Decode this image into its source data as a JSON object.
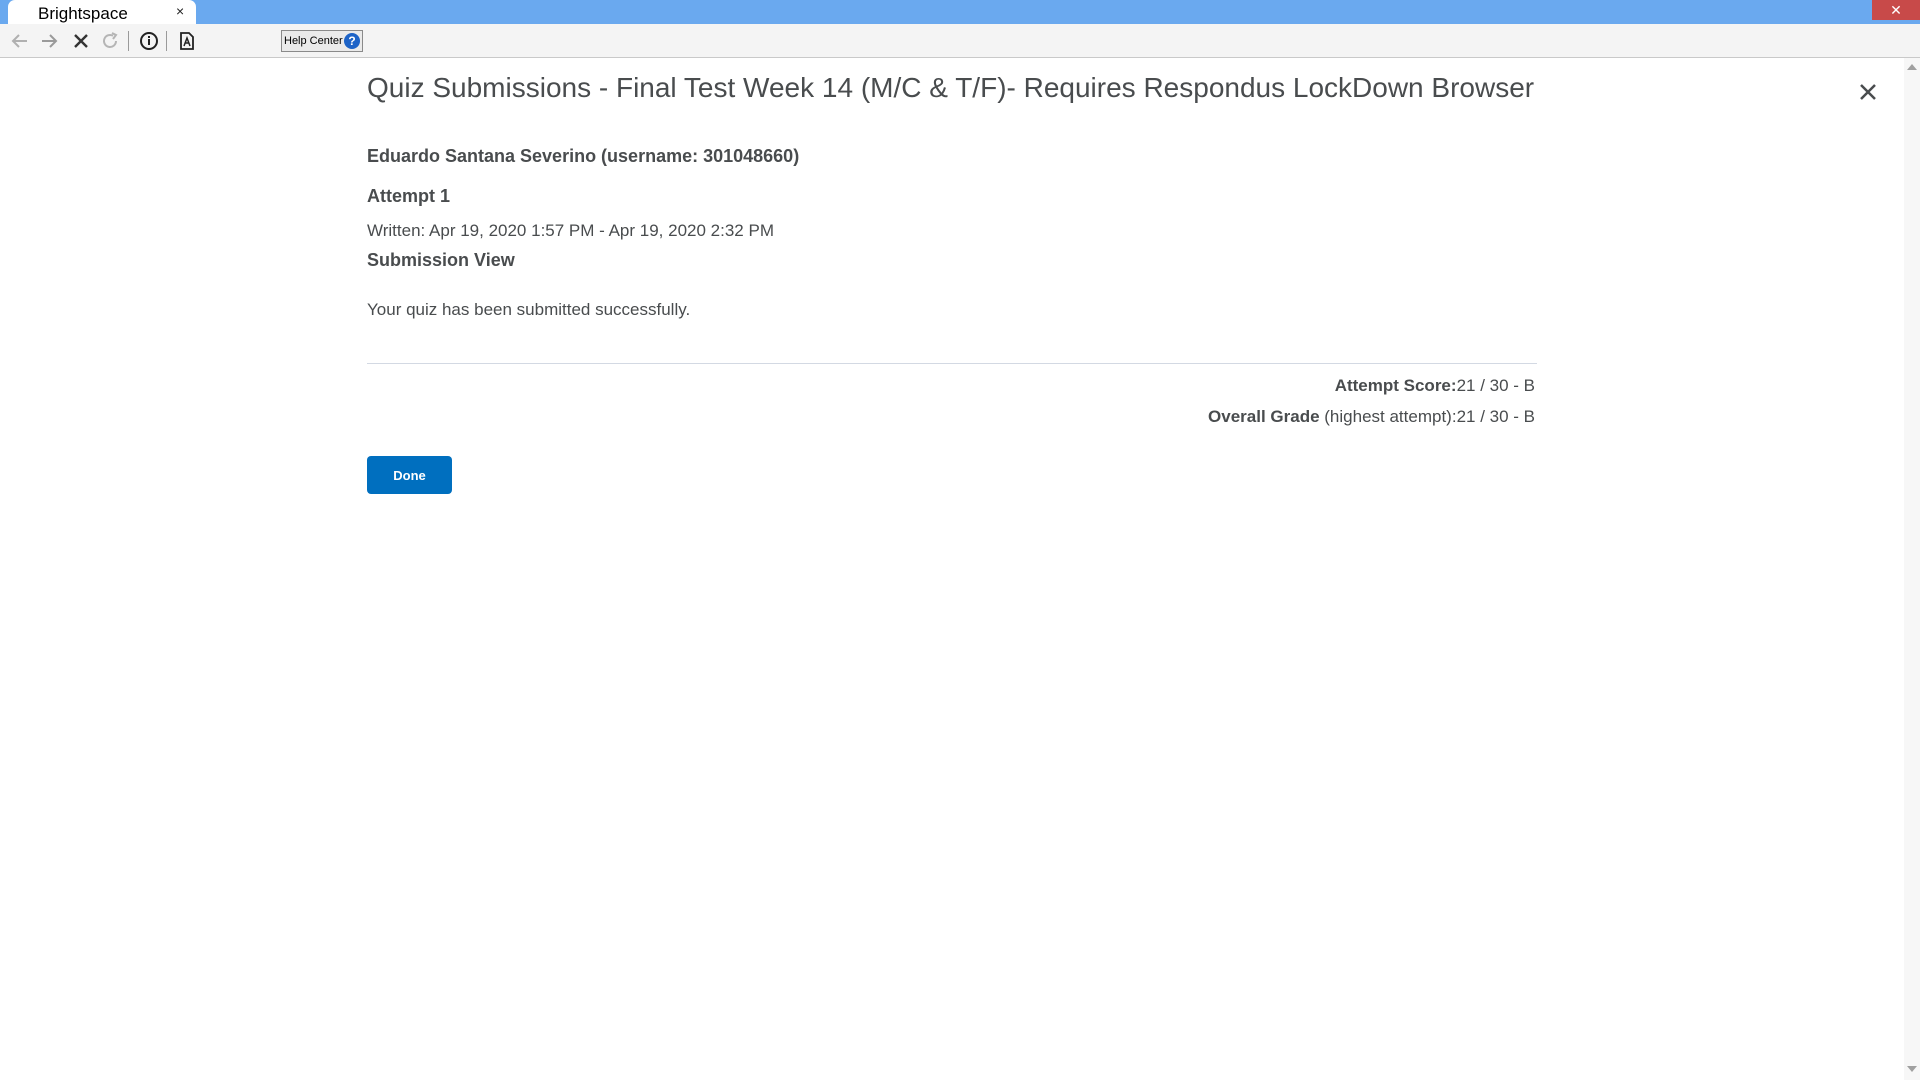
{
  "browser": {
    "tab_title": "Brightspace",
    "tab_close": "×",
    "window_close": "✕",
    "help_center_label": "Help Center",
    "help_icon_glyph": "?",
    "toolbar_icons": [
      "back-arrow-icon",
      "forward-arrow-icon",
      "stop-icon",
      "reload-icon",
      "info-icon",
      "page-icon"
    ]
  },
  "page": {
    "title": "Quiz Submissions - Final Test Week 14 (M/C & T/F)- Requires Respondus LockDown Browser",
    "user": "Eduardo Santana Severino (username: 301048660)",
    "attempt": "Attempt 1",
    "written": "Written: Apr 19, 2020 1:57 PM - Apr 19, 2020 2:32 PM",
    "submission_view": "Submission View",
    "message": "Your quiz has been submitted successfully.",
    "attempt_score_label": "Attempt Score:",
    "attempt_score_value": "21 / 30 - B",
    "overall_grade_label": "Overall Grade",
    "overall_grade_note": " (highest attempt):",
    "overall_grade_value": "21 / 30 - B",
    "done_label": "Done"
  },
  "colors": {
    "titlebar": "#6aa9ef",
    "window_close": "#c84a49",
    "primary_button": "#006fbf",
    "text": "#494c4e"
  }
}
